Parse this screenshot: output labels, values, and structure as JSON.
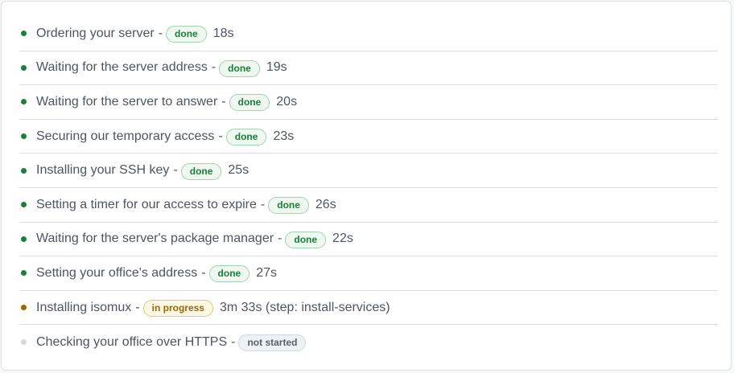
{
  "steps": [
    {
      "label": "Ordering your server",
      "sep": "-",
      "status": "done",
      "status_label": "done",
      "duration": "18s"
    },
    {
      "label": "Waiting for the server address",
      "sep": "-",
      "status": "done",
      "status_label": "done",
      "duration": "19s"
    },
    {
      "label": "Waiting for the server to answer",
      "sep": "-",
      "status": "done",
      "status_label": "done",
      "duration": "20s"
    },
    {
      "label": "Securing our temporary access",
      "sep": "-",
      "status": "done",
      "status_label": "done",
      "duration": "23s"
    },
    {
      "label": "Installing your SSH key",
      "sep": "-",
      "status": "done",
      "status_label": "done",
      "duration": "25s"
    },
    {
      "label": "Setting a timer for our access to expire",
      "sep": "-",
      "status": "done",
      "status_label": "done",
      "duration": "26s"
    },
    {
      "label": "Waiting for the server's package manager",
      "sep": "-",
      "status": "done",
      "status_label": "done",
      "duration": "22s"
    },
    {
      "label": "Setting your office's address",
      "sep": "-",
      "status": "done",
      "status_label": "done",
      "duration": "27s"
    },
    {
      "label": "Installing isomux",
      "sep": "-",
      "status": "progress",
      "status_label": "in progress",
      "duration": "3m 33s (step: install-services)"
    },
    {
      "label": "Checking your office over HTTPS",
      "sep": "-",
      "status": "pending",
      "status_label": "not started",
      "duration": ""
    }
  ],
  "colors": {
    "done": "#1a7f37",
    "progress": "#9a6700",
    "pending": "#d1d9e0"
  },
  "icons": {
    "done": "status-dot-green-icon",
    "progress": "status-dot-amber-icon",
    "pending": "status-dot-gray-icon"
  }
}
